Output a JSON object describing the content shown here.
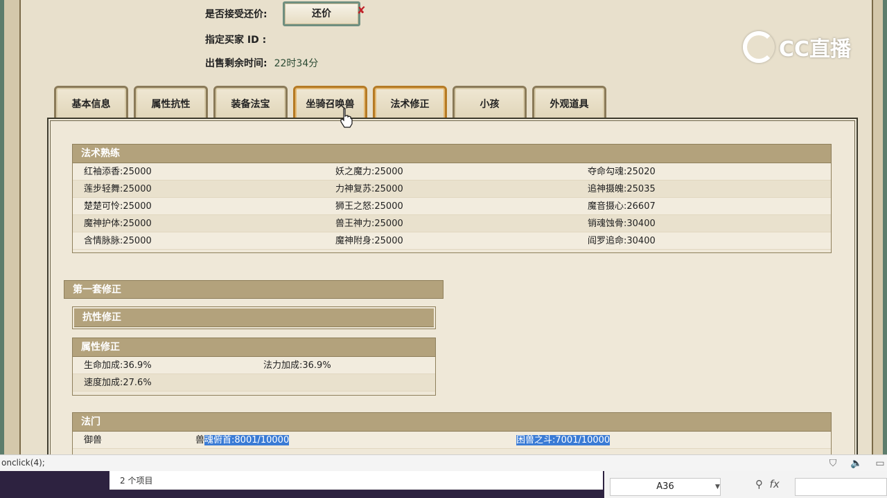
{
  "info": {
    "accept_haggle_label": "是否接受还价:",
    "haggle_button": "还价",
    "buyer_id_label": "指定买家 ID :",
    "remaining_label": "出售剩余时间:",
    "remaining_value": "22时34分"
  },
  "logo": {
    "text": "CC直播"
  },
  "tabs": [
    "基本信息",
    "属性抗性",
    "装备法宝",
    "坐骑召唤兽",
    "法术修正",
    "小孩",
    "外观道具"
  ],
  "skills": {
    "title": "法术熟练",
    "rows": [
      [
        "红袖添香:25000",
        "妖之魔力:25000",
        "夺命勾魂:25020"
      ],
      [
        "莲步轻舞:25000",
        "力神复苏:25000",
        "追神摄魄:25035"
      ],
      [
        "楚楚可怜:25000",
        "狮王之怒:25000",
        "魔音摄心:26607"
      ],
      [
        "魔神护体:25000",
        "兽王神力:25000",
        "销魂蚀骨:30400"
      ],
      [
        "含情脉脉:25000",
        "魔神附身:25000",
        "阎罗追命:30400"
      ]
    ]
  },
  "mod_set": {
    "title": "第一套修正",
    "resist_title": "抗性修正",
    "attr_title": "属性修正",
    "attr_rows": [
      [
        "生命加成:36.9%",
        "法力加成:36.9%"
      ],
      [
        "速度加成:27.6%",
        ""
      ]
    ]
  },
  "school": {
    "title": "法门",
    "row": {
      "name": "御兽",
      "prefix": "兽",
      "item1": "魂俯首:8001/10000",
      "item2": "困兽之斗:7001/10000"
    }
  },
  "statusbar": {
    "text": "onclick(4);"
  },
  "explorer": {
    "count": "2 个项目"
  },
  "excel": {
    "cell_ref": "A36",
    "fx": "fx"
  }
}
